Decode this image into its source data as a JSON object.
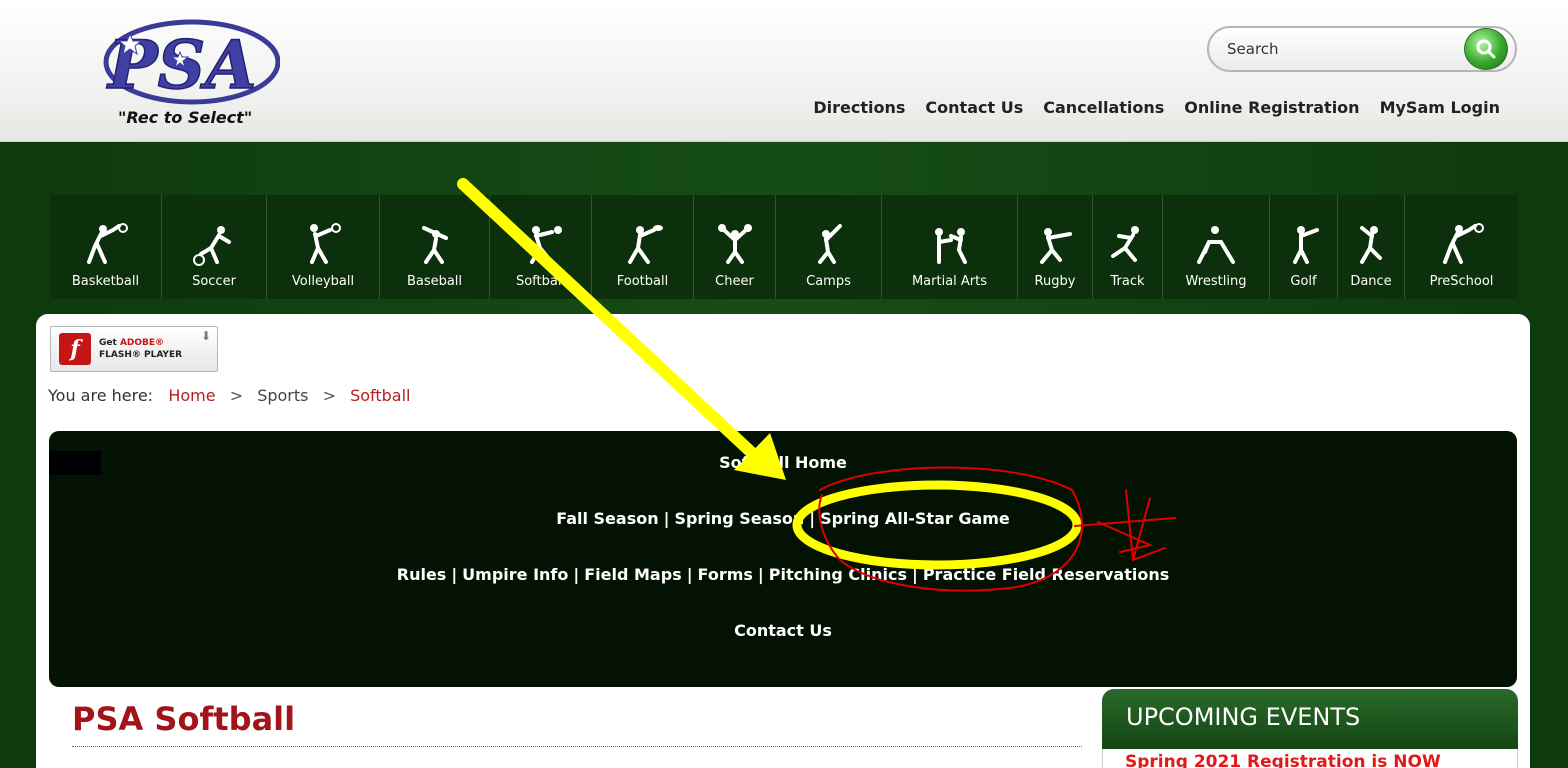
{
  "header": {
    "logo_text": "PSA",
    "tagline": "\"Rec to Select\"",
    "search_placeholder": "Search",
    "top_links": [
      "Directions",
      "Contact Us",
      "Cancellations",
      "Online Registration",
      "MySam Login"
    ]
  },
  "sports": [
    {
      "label": "Basketball",
      "icon": "basketball-player-icon"
    },
    {
      "label": "Soccer",
      "icon": "soccer-player-icon"
    },
    {
      "label": "Volleyball",
      "icon": "volleyball-player-icon"
    },
    {
      "label": "Baseball",
      "icon": "baseball-player-icon"
    },
    {
      "label": "Softball",
      "icon": "softball-player-icon"
    },
    {
      "label": "Football",
      "icon": "football-player-icon"
    },
    {
      "label": "Cheer",
      "icon": "cheer-icon"
    },
    {
      "label": "Camps",
      "icon": "camps-icon"
    },
    {
      "label": "Martial Arts",
      "icon": "martial-arts-icon"
    },
    {
      "label": "Rugby",
      "icon": "rugby-player-icon"
    },
    {
      "label": "Track",
      "icon": "track-runner-icon"
    },
    {
      "label": "Wrestling",
      "icon": "wrestling-icon"
    },
    {
      "label": "Golf",
      "icon": "golfer-icon"
    },
    {
      "label": "Dance",
      "icon": "dancer-icon"
    },
    {
      "label": "PreSchool",
      "icon": "preschool-icon"
    }
  ],
  "flash_badge": {
    "line1_prefix": "Get ",
    "line1_brand": "ADOBE®",
    "line2": "FLASH® PLAYER"
  },
  "breadcrumb": {
    "prefix": "You are here:",
    "items": [
      "Home",
      "Sports",
      "Softball"
    ],
    "separator": ">"
  },
  "softball_nav": {
    "row1": [
      "Softball Home"
    ],
    "row2": [
      "Fall Season",
      "Spring Season",
      "Spring All-Star Game"
    ],
    "row3": [
      "Rules",
      "Umpire Info",
      "Field Maps",
      "Forms",
      "Pitching Clinics",
      "Practice Field Reservations"
    ],
    "row4": [
      "Contact Us"
    ],
    "separator": "|"
  },
  "main": {
    "title": "PSA Softball"
  },
  "events": {
    "heading": "UPCOMING EVENTS",
    "first_item": "Spring 2021 Registration is NOW"
  },
  "colors": {
    "band_green": "#164d16",
    "nav_dark": "#031203",
    "title_red": "#a3141a",
    "event_red": "#e11919",
    "arrow_yellow": "#ffff00",
    "circle_red": "#e00000"
  }
}
